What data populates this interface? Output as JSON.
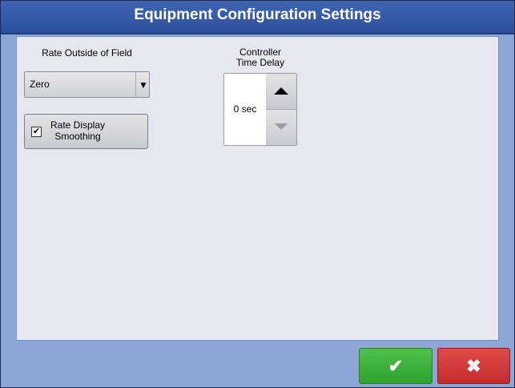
{
  "window": {
    "title": "Equipment Configuration Settings"
  },
  "rate_outside_field": {
    "label": "Rate Outside of Field",
    "selected": "Zero",
    "arrow_icon": "dropdown-triangle-icon"
  },
  "rate_display_smoothing": {
    "label_line1": "Rate Display",
    "label_line2": "Smoothing",
    "checked": true,
    "check_glyph": "✔"
  },
  "controller_delay": {
    "label_line1": "Controller",
    "label_line2": "Time Delay",
    "value": "0 sec"
  },
  "footer": {
    "ok_glyph": "✔",
    "cancel_glyph": "✖"
  },
  "colors": {
    "title_bar": "#3f65b2",
    "frame": "#8ea6d6",
    "ok": "#3bb03b",
    "cancel": "#d23a3a"
  }
}
